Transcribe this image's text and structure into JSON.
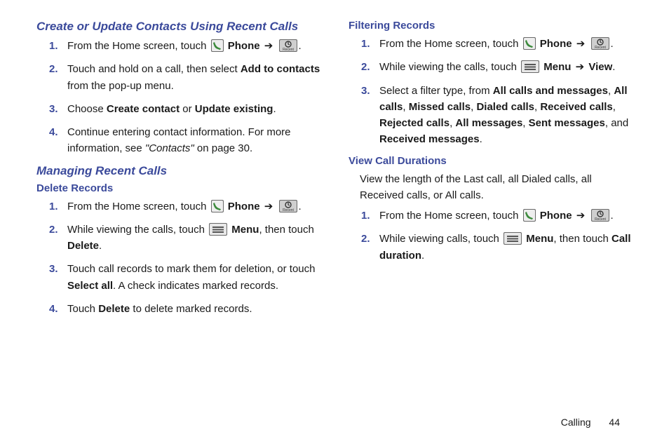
{
  "col1": {
    "h_create": "Create or Update Contacts Using Recent Calls",
    "create": {
      "s1a": "From the Home screen, touch ",
      "s1_phone": "Phone",
      "s1_end": ".",
      "s2a": "Touch and hold on a call, then select ",
      "s2b": "Add to contacts",
      "s2c": " from the pop-up menu.",
      "s3a": "Choose ",
      "s3b": "Create contact",
      "s3c": " or ",
      "s3d": "Update existing",
      "s3e": ".",
      "s4a": "Continue entering contact information. For more information, see ",
      "s4b": "\"Contacts\"",
      "s4c": " on page 30."
    },
    "h_manage": "Managing Recent Calls",
    "h_delete": "Delete Records",
    "del": {
      "s1a": "From the Home screen, touch ",
      "s1_phone": "Phone",
      "s1_end": ".",
      "s2a": "While viewing the calls, touch ",
      "s2_menu": "Menu",
      "s2b": ", then touch ",
      "s2c": "Delete",
      "s2d": ".",
      "s3a": "Touch call records to mark them for deletion, or touch ",
      "s3b": "Select all",
      "s3c": ". A check indicates marked records.",
      "s4a": "Touch ",
      "s4b": "Delete",
      "s4c": " to delete marked records."
    }
  },
  "col2": {
    "h_filter": "Filtering Records",
    "filt": {
      "s1a": "From the Home screen, touch ",
      "s1_phone": "Phone",
      "s1_end": ".",
      "s2a": "While viewing the calls, touch ",
      "s2_menu": "Menu",
      "s2_arrow_end": "View",
      "s2_end": ".",
      "s3a": "Select a filter type, from ",
      "s3b": "All calls and messages",
      "s3c": ", ",
      "s3d": "All calls",
      "s3e": ", ",
      "s3f": "Missed calls",
      "s3g": ", ",
      "s3h": "Dialed calls",
      "s3i": ", ",
      "s3j": "Received calls",
      "s3k": ", ",
      "s3l": "Rejected calls",
      "s3m": ", ",
      "s3n": "All messages",
      "s3o": ", ",
      "s3p": "Sent messages",
      "s3q": ", and ",
      "s3r": "Received messages",
      "s3s": "."
    },
    "h_view": "View Call Durations",
    "view_para": "View the length of the Last call, all Dialed calls, all Received calls, or All calls.",
    "dur": {
      "s1a": "From the Home screen, touch ",
      "s1_phone": "Phone",
      "s1_end": ".",
      "s2a": "While viewing calls, touch ",
      "s2_menu": "Menu",
      "s2b": ", then touch ",
      "s2c": "Call duration",
      "s2d": "."
    }
  },
  "arrow": "➔",
  "footer": {
    "section": "Calling",
    "page": "44"
  }
}
